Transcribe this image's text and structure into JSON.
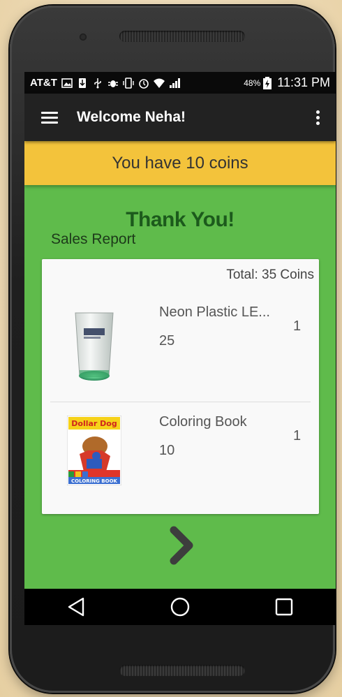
{
  "status_bar": {
    "carrier": "AT&T",
    "battery_percent": "48%",
    "time": "11:31 PM"
  },
  "app_bar": {
    "title": "Welcome Neha!"
  },
  "coins_banner": {
    "text": "You have 10 coins"
  },
  "main": {
    "heading": "Thank You!",
    "subheading": "Sales Report",
    "total": "Total: 35 Coins",
    "items": [
      {
        "name": "Neon Plastic LE...",
        "price": "25",
        "quantity": "1",
        "image": "glass-cup-image"
      },
      {
        "name": "Coloring Book",
        "price": "10",
        "quantity": "1",
        "image": "dollar-dog-book-image"
      }
    ],
    "book_cover_text": {
      "title": "Dollar Dog",
      "subtitle": "COLORING BOOK"
    }
  },
  "colors": {
    "background_green": "#5fbb4b",
    "banner_yellow": "#f3c33b",
    "app_bar": "#222222",
    "heading_green": "#1c5a1c"
  }
}
